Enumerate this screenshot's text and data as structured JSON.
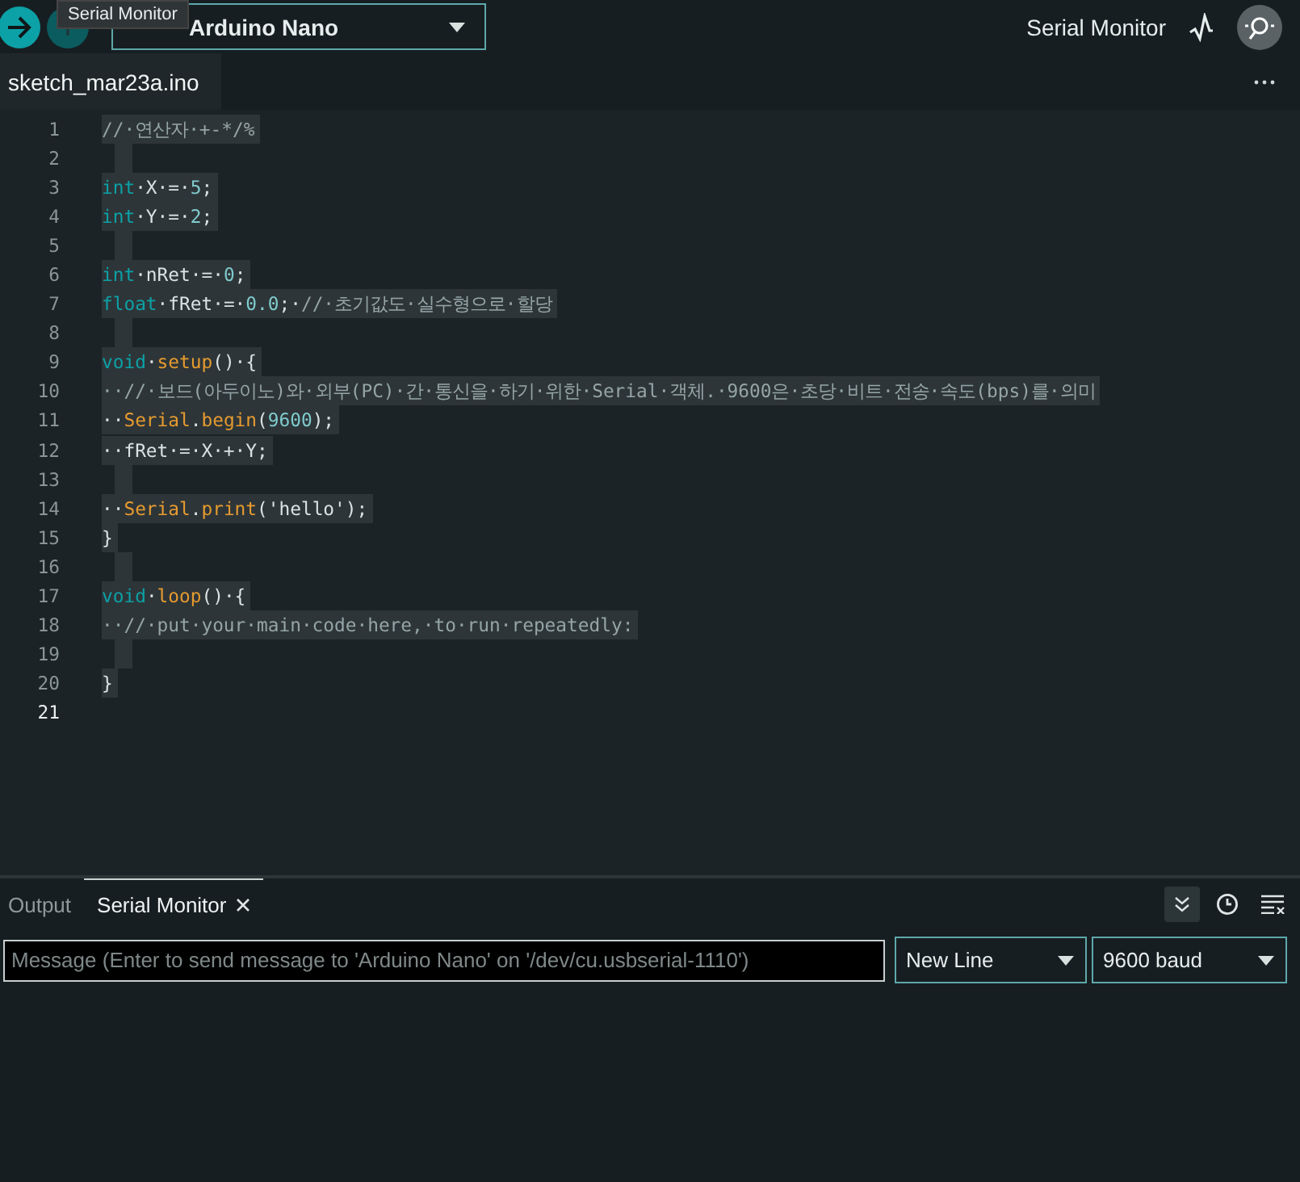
{
  "toolbar": {
    "tooltip": "Serial Monitor",
    "board": "Arduino Nano",
    "serial_monitor_label": "Serial Monitor"
  },
  "editor_tabs": [
    {
      "label": "sketch_mar23a.ino",
      "selected": true
    }
  ],
  "code": [
    {
      "line": "1",
      "selected": true,
      "tokens": [
        {
          "kind": "comment",
          "text": "//·연산자·+-*/%"
        }
      ]
    },
    {
      "line": "2",
      "selected": true
    },
    {
      "line": "3",
      "selected": true,
      "tokens": [
        {
          "kind": "kw",
          "text": "int"
        },
        {
          "kind": "plain",
          "text": "·X·=·"
        },
        {
          "kind": "num",
          "text": "5"
        },
        {
          "kind": "plain",
          "text": ";"
        }
      ]
    },
    {
      "line": "4",
      "selected": true,
      "tokens": [
        {
          "kind": "kw",
          "text": "int"
        },
        {
          "kind": "plain",
          "text": "·Y·=·"
        },
        {
          "kind": "num",
          "text": "2"
        },
        {
          "kind": "plain",
          "text": ";"
        }
      ]
    },
    {
      "line": "5",
      "selected": true
    },
    {
      "line": "6",
      "selected": true,
      "tokens": [
        {
          "kind": "kw",
          "text": "int"
        },
        {
          "kind": "plain",
          "text": "·nRet·=·"
        },
        {
          "kind": "num",
          "text": "0"
        },
        {
          "kind": "plain",
          "text": ";"
        }
      ]
    },
    {
      "line": "7",
      "selected": true,
      "tokens": [
        {
          "kind": "kw",
          "text": "float"
        },
        {
          "kind": "plain",
          "text": "·fRet·=·"
        },
        {
          "kind": "num",
          "text": "0.0"
        },
        {
          "kind": "plain",
          "text": ";·"
        },
        {
          "kind": "comment",
          "text": "//·초기값도·실수형으로·할당"
        }
      ]
    },
    {
      "line": "8",
      "selected": true
    },
    {
      "line": "9",
      "selected": true,
      "tokens": [
        {
          "kind": "kw",
          "text": "void"
        },
        {
          "kind": "plain",
          "text": "·"
        },
        {
          "kind": "fn",
          "text": "setup"
        },
        {
          "kind": "plain",
          "text": "()·{"
        }
      ]
    },
    {
      "line": "10",
      "selected": true,
      "tokens": [
        {
          "kind": "comment",
          "text": "··//·보드(아두이노)와·외부(PC)·간·통신을·하기·위한·Serial·객체.·9600은·초당·비트·전송·속도(bps)를·의미"
        }
      ]
    },
    {
      "line": "11",
      "selected": true,
      "tokens": [
        {
          "kind": "plain",
          "text": "··"
        },
        {
          "kind": "fn",
          "text": "Serial"
        },
        {
          "kind": "plain",
          "text": "."
        },
        {
          "kind": "fn",
          "text": "begin"
        },
        {
          "kind": "plain",
          "text": "("
        },
        {
          "kind": "num",
          "text": "9600"
        },
        {
          "kind": "plain",
          "text": ");"
        }
      ]
    },
    {
      "line": "12",
      "selected": true,
      "tokens": [
        {
          "kind": "plain",
          "text": "··fRet·=·X·+·Y;"
        }
      ]
    },
    {
      "line": "13",
      "selected": true
    },
    {
      "line": "14",
      "selected": true,
      "tokens": [
        {
          "kind": "plain",
          "text": "··"
        },
        {
          "kind": "fn",
          "text": "Serial"
        },
        {
          "kind": "plain",
          "text": "."
        },
        {
          "kind": "fn",
          "text": "print"
        },
        {
          "kind": "plain",
          "text": "('hello');"
        }
      ]
    },
    {
      "line": "15",
      "selected": true,
      "tokens": [
        {
          "kind": "plain",
          "text": "}"
        }
      ]
    },
    {
      "line": "16",
      "selected": true
    },
    {
      "line": "17",
      "selected": true,
      "tokens": [
        {
          "kind": "kw",
          "text": "void"
        },
        {
          "kind": "plain",
          "text": "·"
        },
        {
          "kind": "fn",
          "text": "loop"
        },
        {
          "kind": "plain",
          "text": "()·{"
        }
      ]
    },
    {
      "line": "18",
      "selected": true,
      "tokens": [
        {
          "kind": "comment",
          "text": "··//·put·your·main·code·here,·to·run·repeatedly:"
        }
      ]
    },
    {
      "line": "19",
      "selected": true
    },
    {
      "line": "20",
      "selected": true,
      "tokens": [
        {
          "kind": "plain",
          "text": "}"
        }
      ]
    },
    {
      "line": "21",
      "selected": false
    }
  ],
  "panel_tabs": [
    {
      "label": "Output",
      "selected": false,
      "closable": false
    },
    {
      "label": "Serial Monitor",
      "selected": true,
      "closable": true
    }
  ],
  "message": {
    "placeholder": "Message (Enter to send message to 'Arduino Nano' on '/dev/cu.usbserial-1110')"
  },
  "line_ending": "New Line",
  "baud": "9600 baud"
}
